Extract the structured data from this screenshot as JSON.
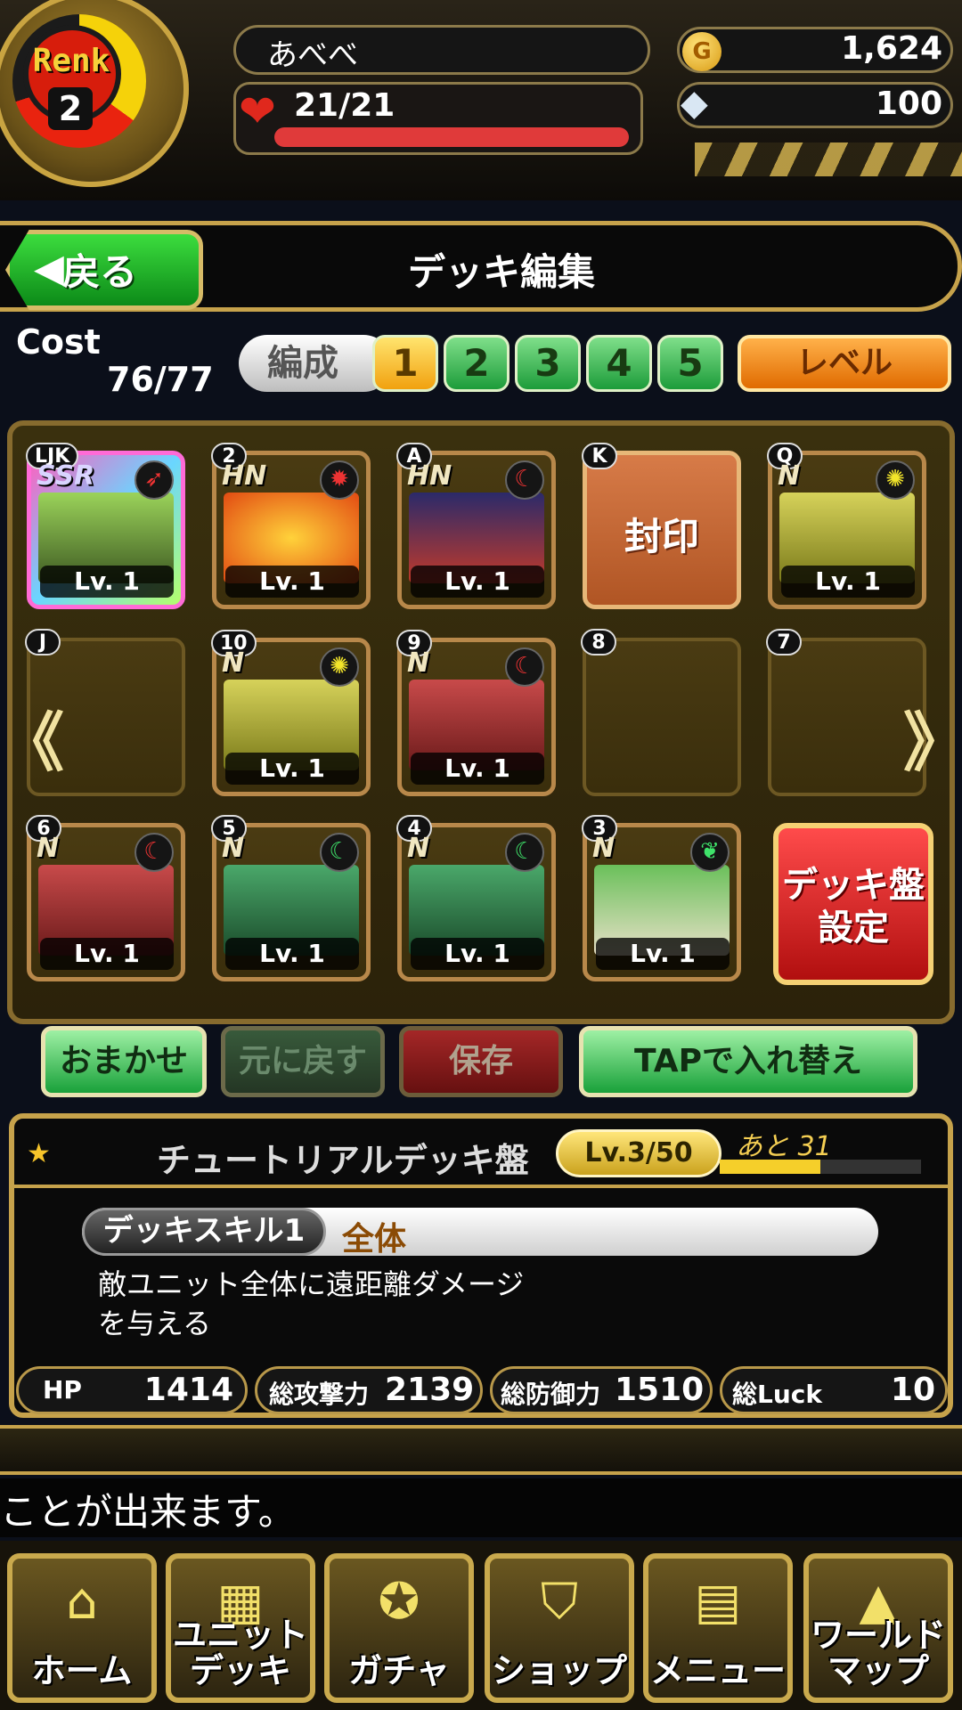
{
  "header": {
    "rank_label": "Renk",
    "rank_value": "2",
    "player_name": "あべべ",
    "hp": "21/21",
    "hp_fill": 1.0,
    "gold": "1,624",
    "gold_icon_text": "G",
    "gems": "100"
  },
  "titlebar": {
    "back_label": "戻る",
    "title": "デッキ編集"
  },
  "cost": {
    "label": "Cost",
    "value": "76/77"
  },
  "formation": {
    "label": "編成",
    "tabs": [
      "1",
      "2",
      "3",
      "4",
      "5"
    ],
    "active_tab": "1",
    "level_button": "レベル"
  },
  "slots": [
    {
      "tag": "LJK",
      "rarity": "SSR",
      "element": "fire",
      "level": "Lv. 1"
    },
    {
      "tag": "2",
      "rarity": "HN",
      "element": "fire",
      "level": "Lv. 1"
    },
    {
      "tag": "A",
      "rarity": "HN",
      "element": "water",
      "level": "Lv. 1"
    },
    {
      "tag": "K",
      "seal": "封印"
    },
    {
      "tag": "Q",
      "rarity": "N",
      "element": "light",
      "level": "Lv. 1"
    },
    {
      "tag": "J"
    },
    {
      "tag": "10",
      "rarity": "N",
      "element": "light",
      "level": "Lv. 1"
    },
    {
      "tag": "9",
      "rarity": "N",
      "element": "water",
      "level": "Lv. 1"
    },
    {
      "tag": "8"
    },
    {
      "tag": "7"
    },
    {
      "tag": "6",
      "rarity": "N",
      "element": "fire",
      "level": "Lv. 1"
    },
    {
      "tag": "5",
      "rarity": "N",
      "element": "wind",
      "level": "Lv. 1"
    },
    {
      "tag": "4",
      "rarity": "N",
      "element": "wind",
      "level": "Lv. 1"
    },
    {
      "tag": "3",
      "rarity": "N",
      "element": "wood",
      "level": "Lv. 1"
    }
  ],
  "deck_board_button": "デッキ盤\n設定",
  "actions": {
    "auto": "おまかせ",
    "revert": "元に戻す",
    "save": "保存",
    "tap_swap": "TAPで入れ替え"
  },
  "deck_info": {
    "name": "チュートリアルデッキ盤",
    "level": "Lv.3/50",
    "remaining": "あと 31",
    "exp_fill": 0.5,
    "skill_label": "デッキスキル1",
    "skill_target": "全体",
    "skill_desc": "敵ユニット全体に遠距離ダメージ\nを与える",
    "stats": [
      {
        "label": "HP",
        "value": "1414"
      },
      {
        "label": "総攻撃力",
        "value": "2139"
      },
      {
        "label": "総防御力",
        "value": "1510"
      },
      {
        "label": "総Luck",
        "value": "10"
      }
    ]
  },
  "ticker": "ことが出来ます。",
  "nav": [
    {
      "label": "ホーム",
      "icon": "home-icon"
    },
    {
      "label": "ユニット\nデッキ",
      "icon": "cards-icon"
    },
    {
      "label": "ガチャ",
      "icon": "gacha-icon"
    },
    {
      "label": "ショップ",
      "icon": "basket-icon"
    },
    {
      "label": "メニュー",
      "icon": "menu-icon"
    },
    {
      "label": "ワールド\nマップ",
      "icon": "map-icon"
    }
  ],
  "colors": {
    "gold_frame": "#c6a24b",
    "green_button": "#19a13a",
    "red_button": "#b10f0f",
    "orange_button": "#e06b00",
    "hp_bar": "#e03a3a"
  }
}
